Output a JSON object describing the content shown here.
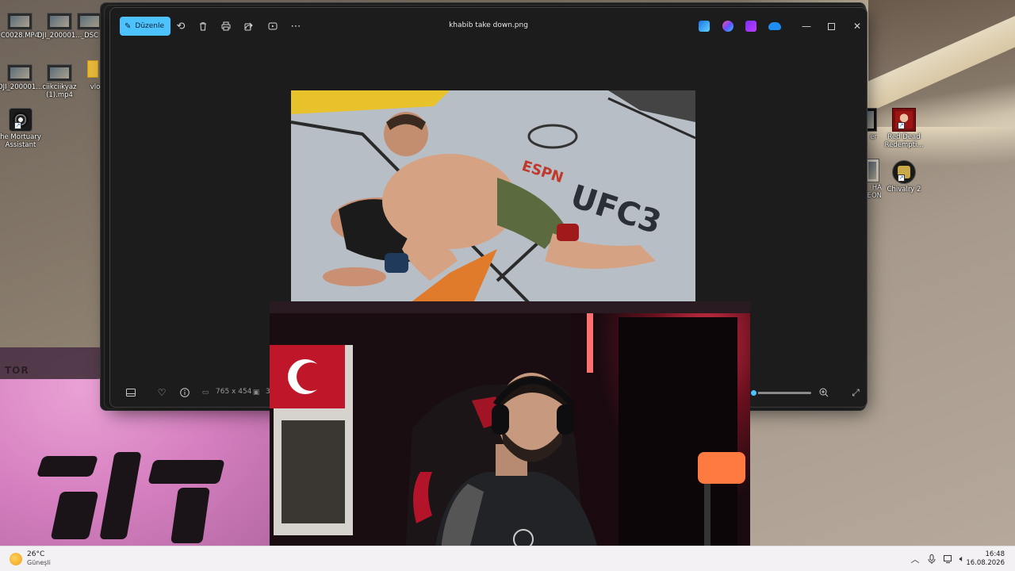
{
  "desktop": {
    "icons": [
      {
        "label": "C0028.MP4",
        "kind": "video"
      },
      {
        "label": "DJI_200001...",
        "kind": "video"
      },
      {
        "label": "_DSC",
        "kind": "video"
      },
      {
        "label": "DJI_200001...",
        "kind": "video"
      },
      {
        "label": "ciikciikyaz (1).mp4",
        "kind": "video"
      },
      {
        "label": "vlo",
        "kind": "folder"
      },
      {
        "label": "he Mortuary Assistant",
        "kind": "game"
      },
      {
        "label": "er",
        "kind": "game"
      },
      {
        "label": "Red Dead Redempti...",
        "kind": "game"
      },
      {
        "label": "HA EON",
        "kind": "game"
      },
      {
        "label": "Chivalry 2",
        "kind": "game"
      }
    ],
    "shirt_brand": "TOR"
  },
  "photos_app": {
    "title": "khabib take down.png",
    "edit_label": "Düzenle",
    "toolbar_icons": [
      "edit-icon",
      "rotate-icon",
      "delete-icon",
      "print-icon",
      "share-icon",
      "slideshow-icon",
      "more-icon"
    ],
    "app_icons": [
      "designer-icon",
      "copilot-icon",
      "clipchamp-icon",
      "onedrive-icon"
    ],
    "bottom": {
      "dimensions": "765 x 454",
      "size_partial": "3",
      "zoom_fraction": 0.02
    }
  },
  "taskbar": {
    "weather_temp": "26°C",
    "weather_desc": "Güneşli",
    "time": "16:48",
    "date": "16.08.2026"
  },
  "colors": {
    "accent": "#4cc2ff",
    "window_bg": "#1c1c1c",
    "taskbar_bg": "#f3f1f3"
  }
}
